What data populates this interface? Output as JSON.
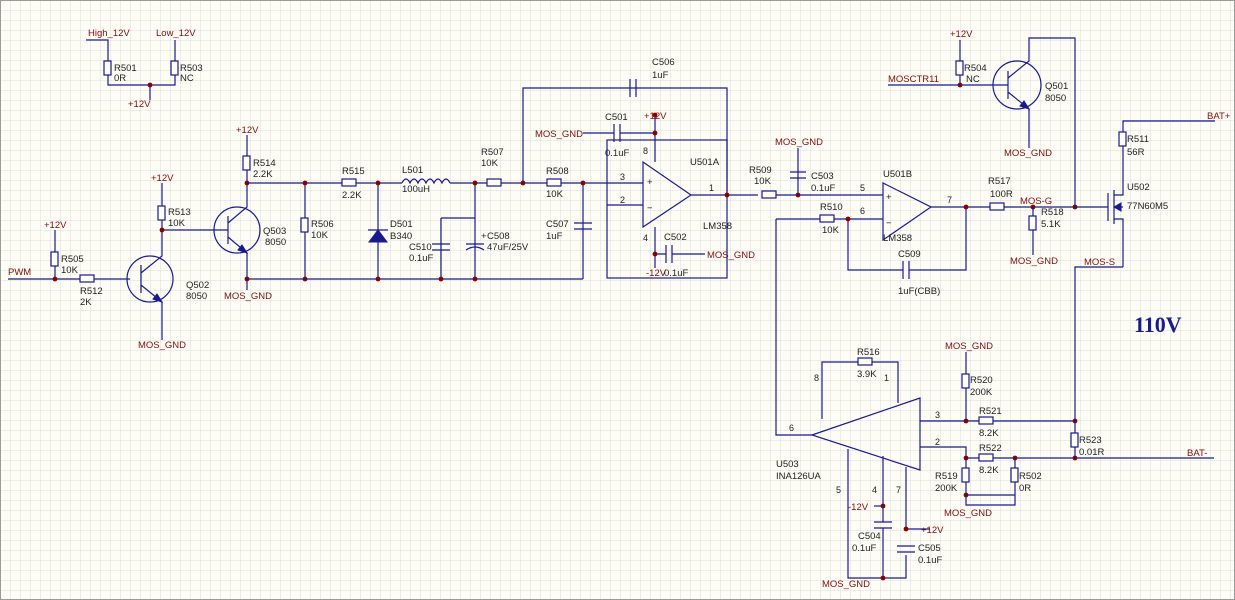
{
  "annotations": {
    "voltage": "110V"
  },
  "nets": {
    "high12v": "High_12V",
    "low12v": "Low_12V",
    "p12v": "+12V",
    "n12v": "-12V",
    "pwm": "PWM",
    "mosgnd": "MOS_GND",
    "mosctr": "MOSCTR11",
    "mosg": "MOS-G",
    "moss": "MOS-S",
    "batp": "BAT+",
    "batn": "BAT-"
  },
  "components": {
    "R501": {
      "ref": "R501",
      "val": "0R"
    },
    "R503": {
      "ref": "R503",
      "val": "NC"
    },
    "R504": {
      "ref": "R504",
      "val": "NC"
    },
    "R505": {
      "ref": "R505",
      "val": "10K"
    },
    "R506": {
      "ref": "R506",
      "val": "10K"
    },
    "R507": {
      "ref": "R507",
      "val": "10K"
    },
    "R508": {
      "ref": "R508",
      "val": "10K"
    },
    "R509": {
      "ref": "R509",
      "val": "10K"
    },
    "R510": {
      "ref": "R510",
      "val": "10K"
    },
    "R511": {
      "ref": "R511",
      "val": "56R"
    },
    "R512": {
      "ref": "R512",
      "val": "2K"
    },
    "R513": {
      "ref": "R513",
      "val": "10K"
    },
    "R514": {
      "ref": "R514",
      "val": "2.2K"
    },
    "R515": {
      "ref": "R515",
      "val": "2.2K"
    },
    "R516": {
      "ref": "R516",
      "val": "3.9K"
    },
    "R517": {
      "ref": "R517",
      "val": "100R"
    },
    "R518": {
      "ref": "R518",
      "val": "5.1K"
    },
    "R519": {
      "ref": "R519",
      "val": "200K"
    },
    "R520": {
      "ref": "R520",
      "val": "200K"
    },
    "R521": {
      "ref": "R521",
      "val": "8.2K"
    },
    "R522": {
      "ref": "R522",
      "val": "8.2K"
    },
    "R523": {
      "ref": "R523",
      "val": "0.01R"
    },
    "R502": {
      "ref": "R502",
      "val": "0R"
    },
    "C501": {
      "ref": "C501",
      "val": "0.1uF"
    },
    "C502": {
      "ref": "C502",
      "val": "0.1uF"
    },
    "C503": {
      "ref": "C503",
      "val": "0.1uF"
    },
    "C504": {
      "ref": "C504",
      "val": "0.1uF"
    },
    "C505": {
      "ref": "C505",
      "val": "0.1uF"
    },
    "C506": {
      "ref": "C506",
      "val": "1uF"
    },
    "C507": {
      "ref": "C507",
      "val": "1uF"
    },
    "C508": {
      "ref": "C508",
      "val": "47uF/25V"
    },
    "C509": {
      "ref": "C509",
      "val": "1uF(CBB)"
    },
    "C510": {
      "ref": "C510",
      "val": "0.1uF"
    },
    "L501": {
      "ref": "L501",
      "val": "100uH"
    },
    "D501": {
      "ref": "D501",
      "val": "B340"
    },
    "Q501": {
      "ref": "Q501",
      "val": "8050"
    },
    "Q502": {
      "ref": "Q502",
      "val": "8050"
    },
    "Q503": {
      "ref": "Q503",
      "val": "8050"
    },
    "Q502b": {
      "ref": "U502",
      "val": "77N60M5"
    },
    "U501A": {
      "ref": "U501A",
      "val": "LM358"
    },
    "U501B": {
      "ref": "U501B",
      "val": "LM358"
    },
    "U503": {
      "ref": "U503",
      "val": "INA126UA"
    }
  },
  "pins": {
    "p1": "1",
    "p2": "2",
    "p3": "3",
    "p4": "4",
    "p5": "5",
    "p6": "6",
    "p7": "7",
    "p8": "8"
  }
}
